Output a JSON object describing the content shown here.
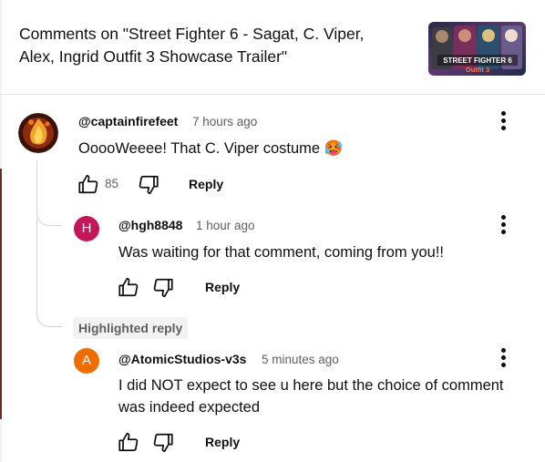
{
  "header": {
    "title": "Comments on \"Street Fighter 6 - Sagat, C. Viper, Alex, Ingrid Outfit 3 Showcase Trailer\"",
    "thumbnail_text_line1": "STREET FIGHTER 6",
    "thumbnail_text_line2": "Outfit 3"
  },
  "comments": [
    {
      "author": "@captainfirefeet",
      "time": "7 hours ago",
      "text": "OoooWeeee! That C. Viper costume 🥵",
      "likes": "85",
      "reply_label": "Reply",
      "avatar_icon": "flame-avatar"
    },
    {
      "author": "@hgh8848",
      "time": "1 hour ago",
      "text": "Was waiting for that comment, coming from you!!",
      "reply_label": "Reply",
      "avatar_letter": "H",
      "avatar_color": "#c2185b"
    },
    {
      "highlight_label": "Highlighted reply",
      "author": "@AtomicStudios-v3s",
      "time": "5 minutes ago",
      "text": "I did NOT expect to see u here but the choice of comment was indeed expected",
      "reply_label": "Reply",
      "avatar_letter": "A",
      "avatar_color": "#ef6c00"
    }
  ],
  "icons": {
    "like": "thumbs-up-icon",
    "dislike": "thumbs-down-icon",
    "more": "more-vert-icon"
  }
}
